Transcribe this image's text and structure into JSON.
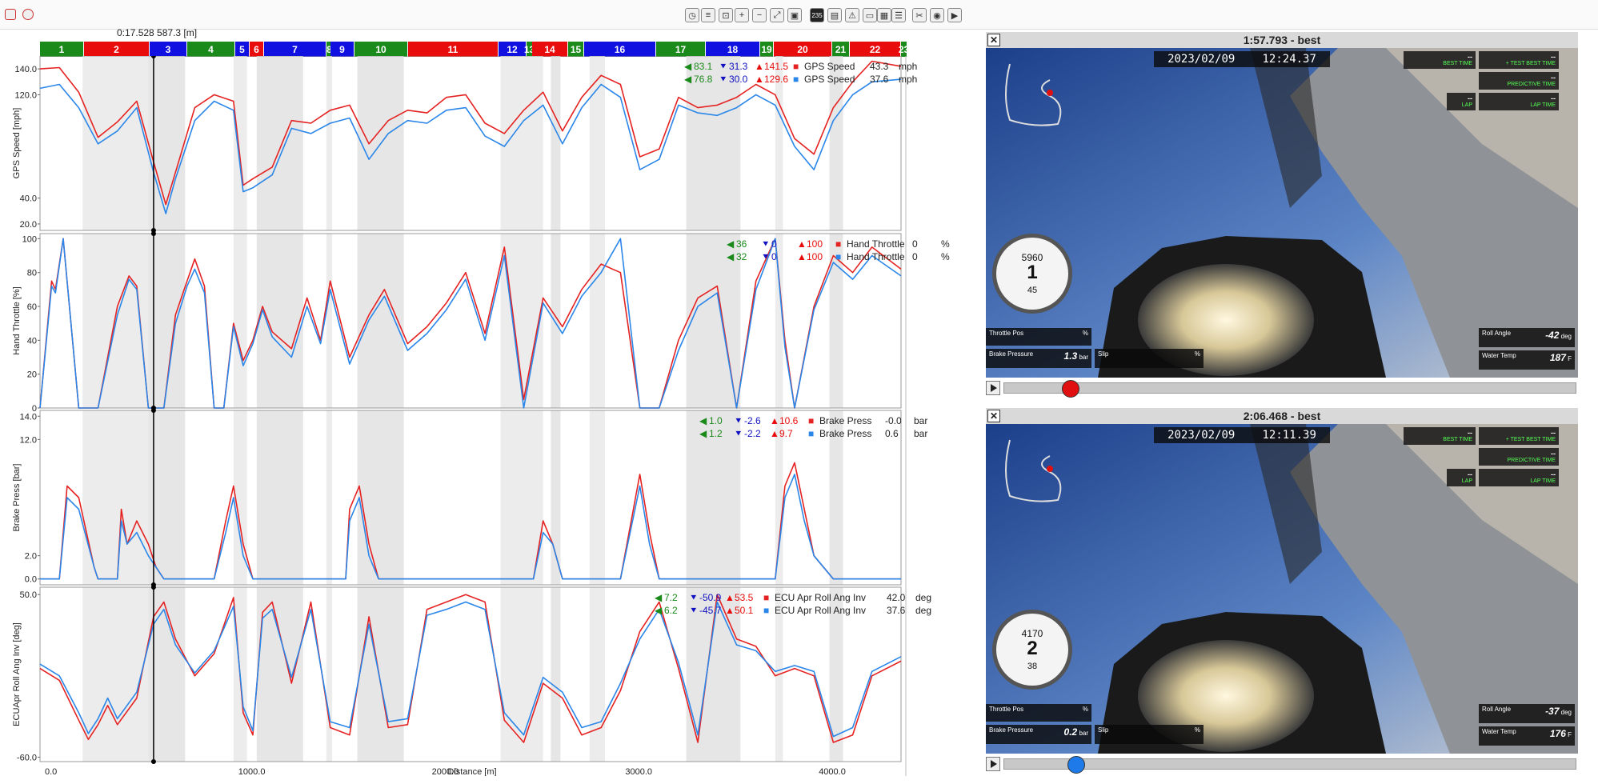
{
  "toolbar": {
    "icons": [
      "stopwatch-icon",
      "ruler-icon",
      "zoom-box-icon",
      "zoom-in-icon",
      "zoom-out-icon",
      "zoom-fit-icon",
      "toolbar-square-icon",
      "toolbar-chart-icon",
      "toolbar-warning-icon",
      "toolbar-window-icon",
      "toolbar-layout-icon",
      "toolbar-list-icon",
      "scissors-icon",
      "camera-icon",
      "video-export-icon"
    ],
    "badge_text": "235"
  },
  "cursor_readout": "0:17.528  587.3 [m]",
  "sectors": [
    "1",
    "2",
    "3",
    "4",
    "5",
    "6",
    "7",
    "8",
    "9",
    "10",
    "11",
    "12",
    "13",
    "14",
    "15",
    "16",
    "17",
    "18",
    "19",
    "20",
    "21",
    "22",
    "23"
  ],
  "chart_data": [
    {
      "type": "line",
      "ylabel": "GPS Speed [mph]",
      "yticks": [
        "140.0",
        "120.0",
        "40.0",
        "20.0"
      ],
      "legend": [
        {
          "min_left": "83.1",
          "min": "31.3",
          "max": "141.5",
          "name": "GPS Speed",
          "value": "43.3",
          "unit": "mph",
          "color": "#e52222"
        },
        {
          "min_left": "76.8",
          "min": "30.0",
          "max": "129.6",
          "name": "GPS Speed",
          "value": "37.6",
          "unit": "mph",
          "color": "#2a86e8"
        }
      ],
      "ylim": [
        15,
        150
      ],
      "x": [
        0,
        100,
        200,
        300,
        400,
        500,
        587,
        650,
        700,
        800,
        900,
        1000,
        1050,
        1100,
        1200,
        1300,
        1400,
        1500,
        1600,
        1700,
        1800,
        1900,
        2000,
        2100,
        2200,
        2300,
        2400,
        2500,
        2600,
        2700,
        2800,
        2900,
        3000,
        3100,
        3200,
        3300,
        3400,
        3500,
        3600,
        3700,
        3800,
        3900,
        4000,
        4100,
        4200,
        4300,
        4450
      ],
      "series": [
        {
          "color": "#e52222",
          "values": [
            140,
            141,
            122,
            87,
            99,
            115,
            68,
            35,
            60,
            110,
            120,
            115,
            50,
            55,
            64,
            100,
            98,
            108,
            112,
            82,
            100,
            108,
            106,
            118,
            120,
            98,
            90,
            108,
            122,
            92,
            118,
            135,
            128,
            72,
            78,
            118,
            110,
            112,
            118,
            128,
            120,
            86,
            74,
            110,
            130,
            146,
            142
          ]
        },
        {
          "color": "#2a86e8",
          "values": [
            125,
            128,
            110,
            82,
            92,
            110,
            60,
            28,
            55,
            100,
            115,
            108,
            45,
            48,
            58,
            94,
            90,
            98,
            102,
            70,
            90,
            100,
            98,
            108,
            110,
            88,
            80,
            100,
            112,
            82,
            110,
            128,
            118,
            62,
            70,
            112,
            106,
            104,
            110,
            120,
            112,
            80,
            62,
            100,
            120,
            130,
            132
          ]
        }
      ]
    },
    {
      "type": "line",
      "ylabel": "Hand Throttle [%]",
      "yticks": [
        "100",
        "80",
        "60",
        "40",
        "20",
        "0"
      ],
      "legend": [
        {
          "min_left": "36",
          "min": "0",
          "max": "100",
          "name": "Hand Throttle",
          "value": "0",
          "unit": "%",
          "color": "#e52222"
        },
        {
          "min_left": "32",
          "min": "0",
          "max": "100",
          "name": "Hand Throttle",
          "value": "0",
          "unit": "%",
          "color": "#2a86e8"
        }
      ],
      "ylim": [
        0,
        103
      ],
      "x": [
        0,
        60,
        80,
        120,
        200,
        260,
        300,
        400,
        460,
        500,
        560,
        590,
        640,
        700,
        760,
        800,
        850,
        900,
        950,
        1000,
        1050,
        1100,
        1150,
        1200,
        1300,
        1380,
        1450,
        1500,
        1600,
        1700,
        1780,
        1900,
        2000,
        2100,
        2200,
        2300,
        2400,
        2500,
        2600,
        2700,
        2800,
        2900,
        3000,
        3100,
        3200,
        3300,
        3400,
        3500,
        3600,
        3700,
        3800,
        3850,
        3900,
        4000,
        4100,
        4200,
        4300,
        4450
      ],
      "series": [
        {
          "color": "#e52222",
          "values": [
            0,
            75,
            70,
            100,
            0,
            0,
            0,
            60,
            78,
            72,
            0,
            0,
            0,
            55,
            75,
            88,
            72,
            0,
            0,
            50,
            28,
            40,
            60,
            45,
            35,
            65,
            40,
            75,
            30,
            55,
            70,
            38,
            48,
            62,
            80,
            44,
            95,
            5,
            65,
            48,
            70,
            85,
            80,
            0,
            0,
            40,
            65,
            72,
            0,
            75,
            100,
            40,
            0,
            60,
            90,
            80,
            95,
            82
          ]
        },
        {
          "color": "#2a86e8",
          "values": [
            0,
            72,
            68,
            100,
            0,
            0,
            0,
            55,
            76,
            70,
            0,
            0,
            0,
            50,
            72,
            82,
            68,
            0,
            0,
            48,
            25,
            38,
            58,
            42,
            30,
            60,
            38,
            70,
            26,
            52,
            66,
            34,
            44,
            58,
            76,
            40,
            90,
            0,
            62,
            44,
            66,
            80,
            100,
            0,
            0,
            34,
            60,
            68,
            0,
            70,
            100,
            36,
            0,
            58,
            86,
            76,
            90,
            78
          ]
        }
      ]
    },
    {
      "type": "line",
      "ylabel": "Brake Press [bar]",
      "yticks": [
        "14.0",
        "12.0",
        "2.0",
        "0.0"
      ],
      "legend": [
        {
          "min_left": "1.0",
          "min": "-2.6",
          "max": "10.6",
          "name": "Brake Press",
          "value": "-0.0",
          "unit": "bar",
          "color": "#e52222"
        },
        {
          "min_left": "1.2",
          "min": "-2.2",
          "max": "9.7",
          "name": "Brake Press",
          "value": "0.6",
          "unit": "bar",
          "color": "#2a86e8"
        }
      ],
      "ylim": [
        -0.5,
        14.5
      ],
      "x": [
        0,
        80,
        100,
        140,
        200,
        280,
        300,
        360,
        400,
        420,
        450,
        500,
        560,
        600,
        640,
        700,
        820,
        850,
        900,
        960,
        1000,
        1050,
        1100,
        1500,
        1580,
        1600,
        1650,
        1700,
        1750,
        2000,
        2400,
        2550,
        2600,
        2650,
        2700,
        3000,
        3100,
        3150,
        3200,
        3300,
        3700,
        3800,
        3850,
        3900,
        3950,
        4000,
        4100,
        4450
      ],
      "series": [
        {
          "color": "#e52222",
          "values": [
            0,
            0,
            0,
            8,
            7,
            1,
            0,
            0,
            0,
            6,
            3,
            5,
            3,
            1,
            0,
            0,
            0,
            0,
            0,
            5,
            8,
            3,
            0,
            0,
            0,
            6,
            8,
            3,
            0,
            0,
            0,
            0,
            5,
            3,
            0,
            0,
            9,
            4,
            0,
            0,
            0,
            0,
            8,
            10,
            6,
            2,
            0,
            0
          ]
        },
        {
          "color": "#2a86e8",
          "values": [
            0,
            0,
            0,
            7,
            6,
            1,
            0,
            0,
            0,
            5,
            3,
            4,
            2,
            1,
            0,
            0,
            0,
            0,
            0,
            4,
            7,
            2,
            0,
            0,
            0,
            5,
            7,
            2,
            0,
            0,
            0,
            0,
            4,
            3,
            0,
            0,
            8,
            3,
            0,
            0,
            0,
            0,
            7,
            9,
            5,
            2,
            0,
            0
          ]
        }
      ]
    },
    {
      "type": "line",
      "ylabel": "ECUApr Roll Ang Inv [deg]",
      "yticks": [
        "50.0",
        "-60.0"
      ],
      "legend": [
        {
          "min_left": "7.2",
          "min": "-50.9",
          "max": "53.5",
          "name": "ECU Apr Roll Ang Inv",
          "value": "42.0",
          "unit": "deg",
          "color": "#e52222"
        },
        {
          "min_left": "6.2",
          "min": "-45.7",
          "max": "50.1",
          "name": "ECU Apr Roll Ang Inv",
          "value": "37.6",
          "unit": "deg",
          "color": "#2a86e8"
        }
      ],
      "ylim": [
        -63,
        55
      ],
      "x": [
        0,
        100,
        200,
        250,
        300,
        350,
        400,
        500,
        587,
        640,
        700,
        800,
        900,
        1000,
        1050,
        1100,
        1150,
        1200,
        1300,
        1400,
        1500,
        1600,
        1700,
        1800,
        1900,
        2000,
        2100,
        2200,
        2300,
        2400,
        2500,
        2600,
        2700,
        2800,
        2900,
        3000,
        3100,
        3200,
        3300,
        3400,
        3500,
        3600,
        3700,
        3800,
        3900,
        4000,
        4100,
        4200,
        4300,
        4450
      ],
      "series": [
        {
          "color": "#e52222",
          "values": [
            0,
            -8,
            -35,
            -48,
            -38,
            -25,
            -38,
            -20,
            35,
            45,
            20,
            -5,
            10,
            48,
            -30,
            -45,
            38,
            45,
            -10,
            45,
            -40,
            -45,
            35,
            -40,
            -38,
            40,
            45,
            50,
            45,
            -35,
            -50,
            -10,
            -20,
            -45,
            -40,
            -15,
            25,
            45,
            0,
            -50,
            50,
            20,
            15,
            -5,
            0,
            -5,
            -50,
            -45,
            -5,
            5
          ]
        },
        {
          "color": "#2a86e8",
          "values": [
            3,
            -5,
            -30,
            -44,
            -34,
            -20,
            -34,
            -16,
            30,
            40,
            16,
            -3,
            12,
            42,
            -26,
            -42,
            34,
            40,
            -6,
            40,
            -36,
            -40,
            30,
            -36,
            -34,
            36,
            40,
            45,
            40,
            -30,
            -45,
            -6,
            -16,
            -40,
            -36,
            -10,
            20,
            40,
            4,
            -45,
            45,
            16,
            12,
            -2,
            2,
            -2,
            -46,
            -40,
            -2,
            8
          ]
        }
      ]
    }
  ],
  "x_axis": {
    "label": "Distance [m]",
    "ticks": [
      "0.0",
      "1000.0",
      "2000.0",
      "3000.0",
      "4000.0"
    ],
    "xlim": [
      0,
      4450
    ],
    "cursor_x": 587,
    "shaded_ranges": [
      [
        220,
        560
      ],
      [
        560,
        750
      ],
      [
        1000,
        1070
      ],
      [
        1120,
        1360
      ],
      [
        1480,
        1510
      ],
      [
        1640,
        1880
      ],
      [
        2380,
        2600
      ],
      [
        2640,
        2690
      ],
      [
        2840,
        2920
      ],
      [
        3340,
        3620
      ],
      [
        3800,
        3840
      ],
      [
        4080,
        4150
      ]
    ]
  },
  "videos": [
    {
      "title": "1:57.793 - best",
      "date": "2023/02/09",
      "time": "12:24.37",
      "rpm": "5960",
      "gear": "1",
      "speed": "45",
      "throttle_label": "Throttle Pos",
      "throttle_unit": "%",
      "brake_label": "Brake Pressure",
      "brake_value": "1.3",
      "brake_unit": "bar",
      "slip_label": "Slip",
      "slip_unit": "%",
      "roll_label": "Roll Angle",
      "roll_value": "-42",
      "roll_unit": "deg",
      "water_label": "Water Temp",
      "water_value": "187",
      "water_unit": "F",
      "scrub_position": 0.1,
      "knob_color": "#e01010"
    },
    {
      "title": "2:06.468 - best",
      "date": "2023/02/09",
      "time": "12:11.39",
      "rpm": "4170",
      "gear": "2",
      "speed": "38",
      "throttle_label": "Throttle Pos",
      "throttle_unit": "%",
      "brake_label": "Brake Pressure",
      "brake_value": "0.2",
      "brake_unit": "bar",
      "slip_label": "Slip",
      "slip_unit": "%",
      "roll_label": "Roll Angle",
      "roll_value": "-37",
      "roll_unit": "deg",
      "water_label": "Water Temp",
      "water_value": "176",
      "water_unit": "F",
      "scrub_position": 0.11,
      "knob_color": "#1e7ae8"
    }
  ],
  "hud_labels": {
    "best_time": "BEST TIME",
    "test_best_time": "+ TEST BEST TIME",
    "predictive_time": "PREDICTIVE TIME",
    "lap": "LAP",
    "lap_time": "LAP TIME",
    "dash": "--"
  }
}
